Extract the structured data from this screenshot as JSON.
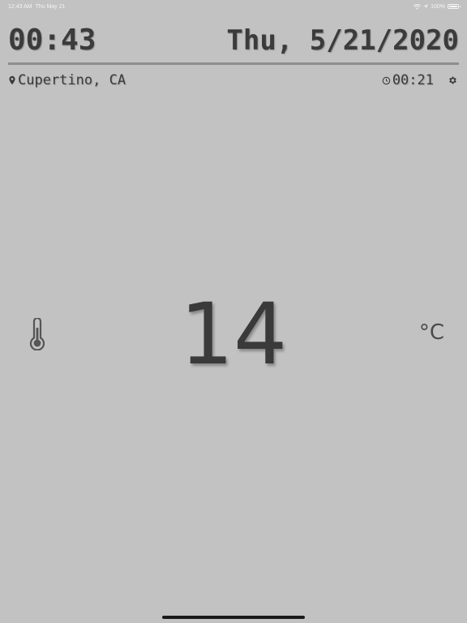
{
  "status_bar": {
    "time": "12:43 AM",
    "date": "Thu May 21",
    "battery": "100%",
    "wifi_icon": "wifi-icon",
    "location_icon": "location-arrow-icon",
    "battery_icon": "battery-icon"
  },
  "header": {
    "time": "00:43",
    "date": "Thu, 5/21/2020"
  },
  "location": {
    "name": "Cupertino, CA",
    "icon": "map-pin-icon"
  },
  "timer": {
    "value": "00:21",
    "icon": "clock-icon"
  },
  "settings": {
    "icon": "gear-icon"
  },
  "temperature": {
    "value": "14",
    "unit": "°C",
    "icon": "thermometer-icon"
  },
  "colors": {
    "background": "#c2c2c2",
    "text": "#3a3a3a",
    "divider": "#8e8e8e"
  }
}
